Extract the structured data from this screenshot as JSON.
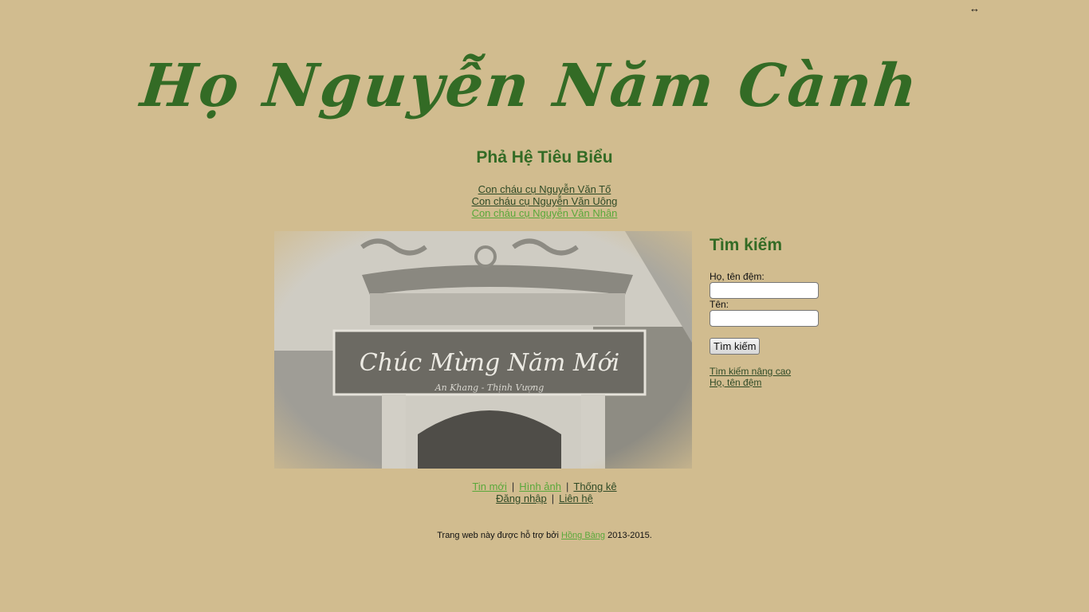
{
  "header": {
    "logo_text": "Họ Nguyễn Năm Cành",
    "title": "Phả Hệ Tiêu Biểu"
  },
  "family_links": [
    "Con cháu cụ Nguyễn Văn Tố",
    "Con cháu cụ Nguyễn Văn Uông",
    "Con cháu cụ Nguyễn Văn Nhân"
  ],
  "photo": {
    "banner_text": "Chúc Mừng Năm Mới",
    "banner_subtext": "An Khang - Thịnh Vượng"
  },
  "search": {
    "heading": "Tìm kiếm",
    "surname_label": "Họ, tên đệm:",
    "name_label": "Tên:",
    "button_label": "Tìm kiếm",
    "advanced_link": "Tìm kiếm nâng cao",
    "surname_link": "Họ, tên đệm"
  },
  "nav": {
    "news": "Tin mới",
    "images": "Hình ảnh",
    "stats": "Thống kê",
    "login": "Đăng nhập",
    "contact": "Liên hệ",
    "separator": "|"
  },
  "footer": {
    "prefix": "Trang web này được hỗ trợ bởi",
    "link": "Hồng Bàng",
    "suffix": "2013-2015."
  },
  "colors": {
    "background": "#d1bc8f",
    "heading_green": "#336b25",
    "link_dark": "#2f4a26",
    "link_light": "#5aa83b"
  },
  "icons": {
    "resize": "horizontal-resize-icon"
  }
}
